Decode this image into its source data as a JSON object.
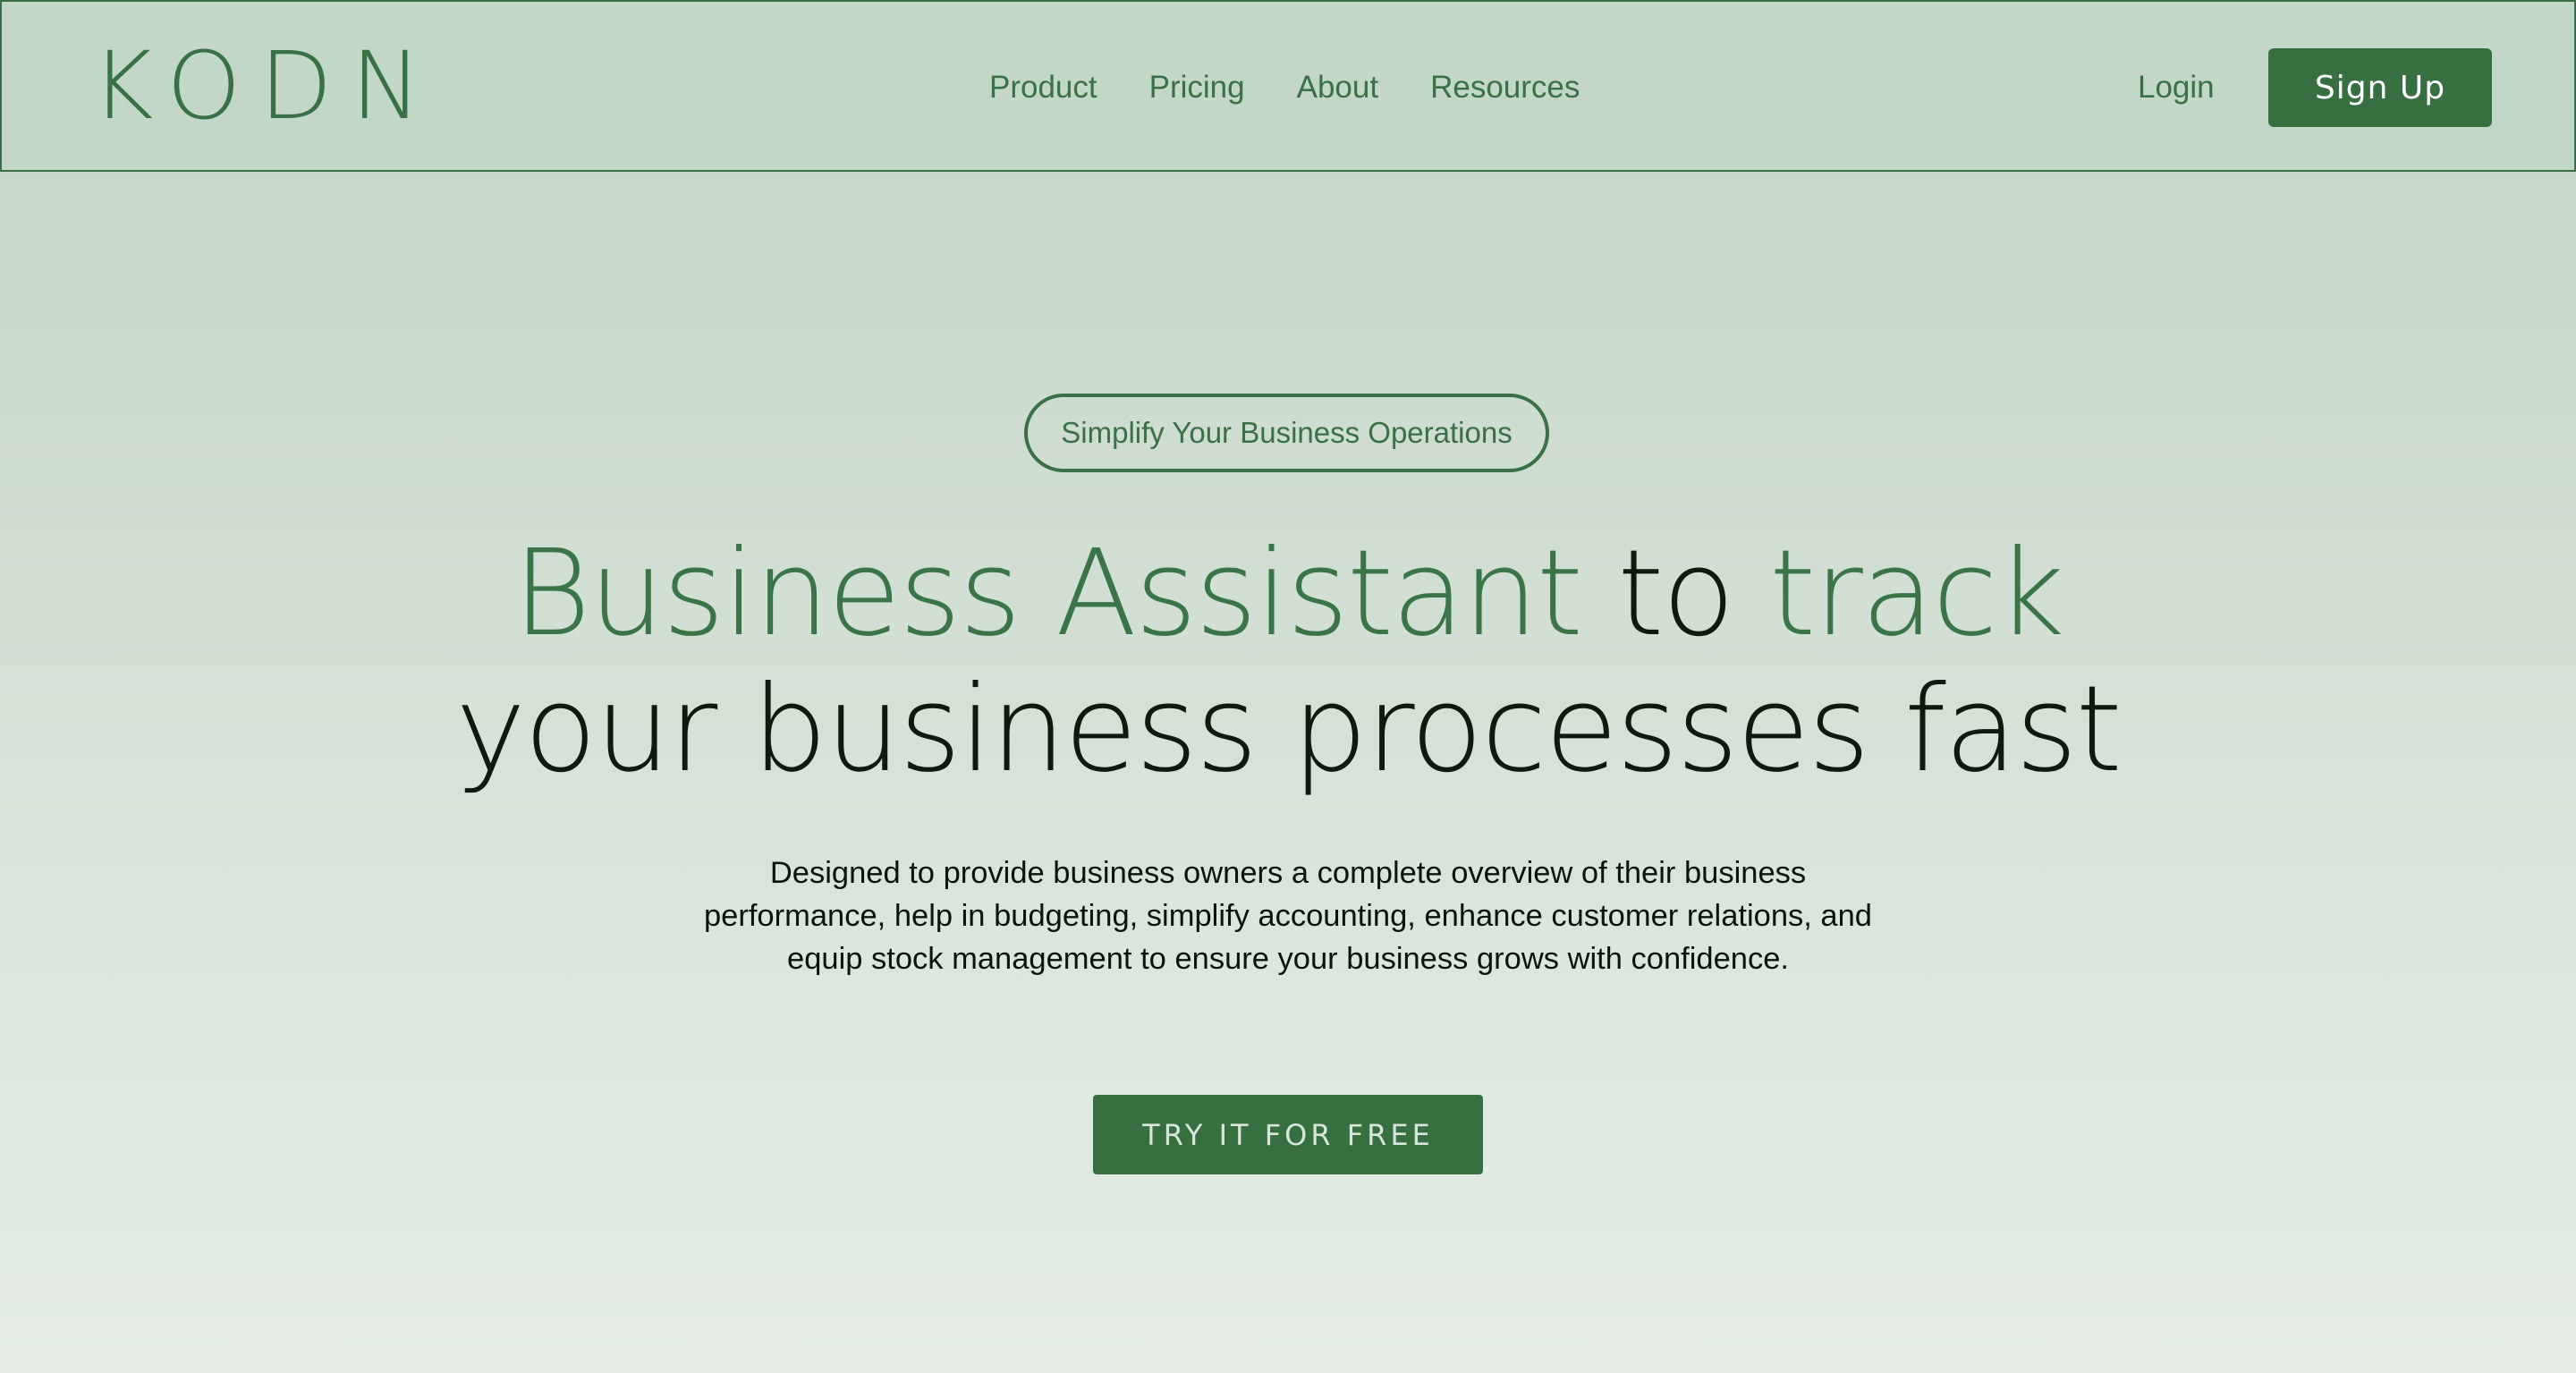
{
  "brand": {
    "logo_text": "KODN",
    "accent_color": "#376f41",
    "background_color": "#c3d7c6"
  },
  "nav": {
    "links": [
      "Product",
      "Pricing",
      "About",
      "Resources"
    ],
    "login_label": "Login",
    "signup_label": "Sign Up"
  },
  "hero": {
    "tag": "Simplify Your Business Operations",
    "headline": {
      "part1": "Business Assistant",
      "part2": "to",
      "part3": "track",
      "line2": "your business processes fast"
    },
    "description": "Designed to provide business owners a complete overview of their business performance, help in budgeting, simplify accounting, enhance customer relations, and equip stock management to ensure your business grows with confidence.",
    "cta_label": "TRY IT FOR FREE"
  }
}
